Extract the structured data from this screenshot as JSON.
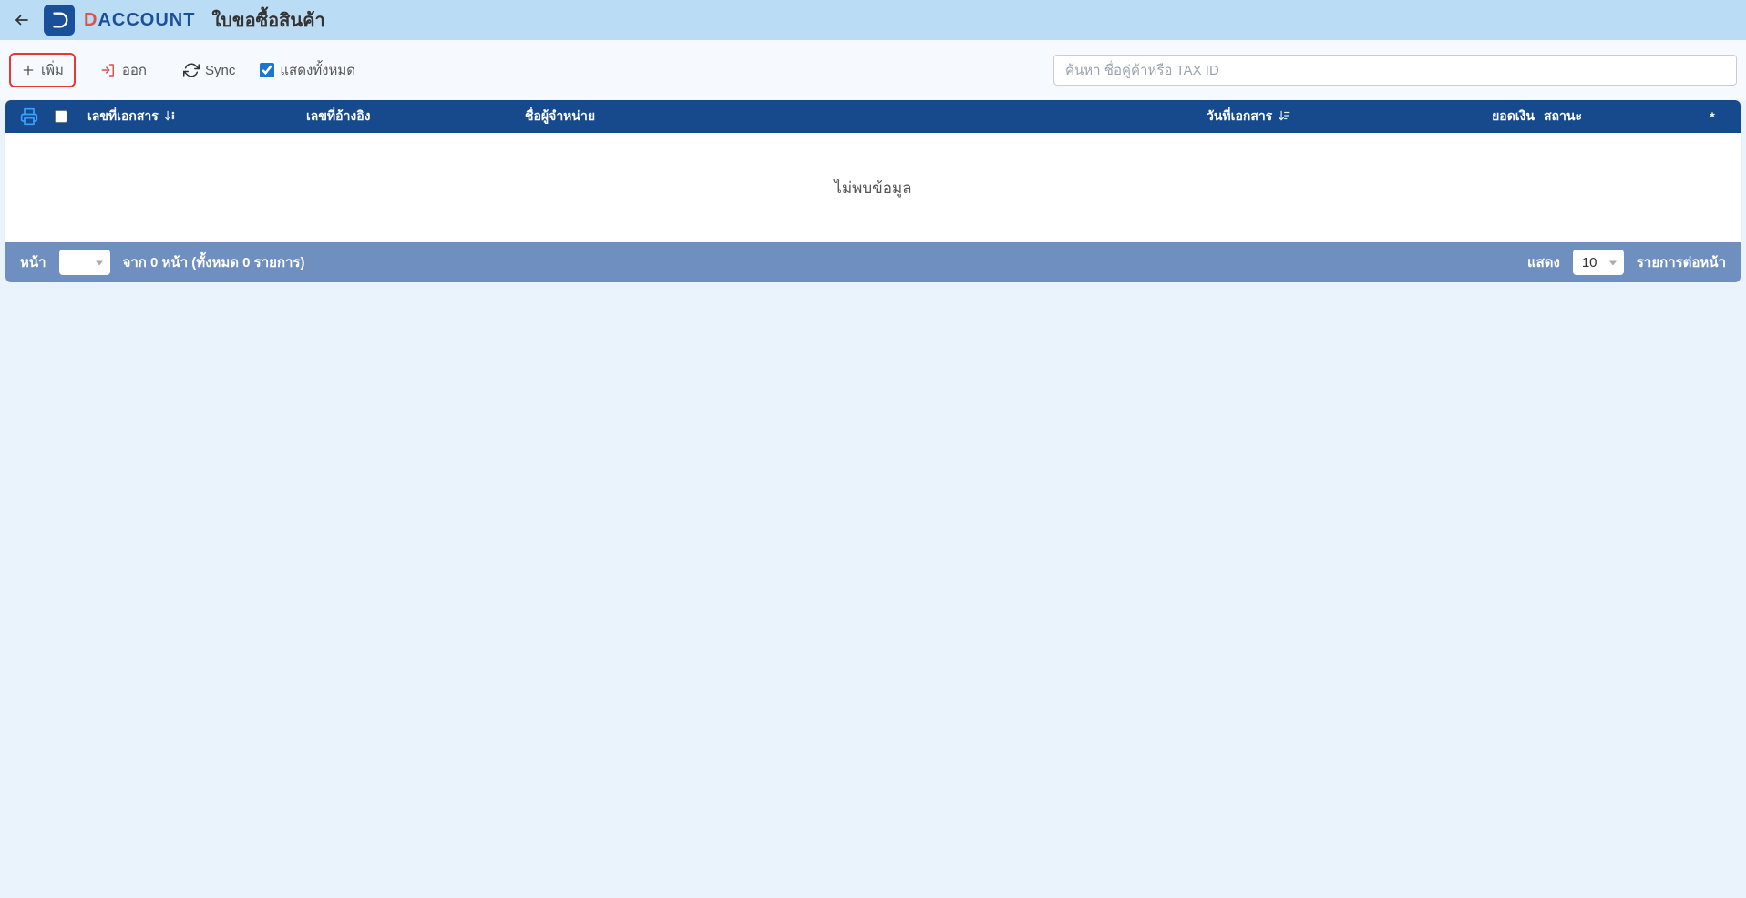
{
  "header": {
    "brand_d": "D",
    "brand_rest": "ACCOUNT",
    "page_title": "ใบขอซื้อสินค้า"
  },
  "toolbar": {
    "add_label": "เพิ่ม",
    "export_label": "ออก",
    "sync_label": "Sync",
    "show_all_label": "แสดงทั้งหมด",
    "show_all_checked": true,
    "search_placeholder": "ค้นหา ชื่อคู่ค้าหรือ TAX ID"
  },
  "table": {
    "columns": {
      "doc_no": "เลขที่เอกสาร",
      "ref_no": "เลขที่อ้างอิง",
      "vendor": "ชื่อผู้จำหน่าย",
      "doc_date": "วันที่เอกสาร",
      "amount": "ยอดเงิน",
      "status": "สถานะ",
      "star": "*"
    },
    "empty_message": "ไม่พบข้อมูล"
  },
  "pagination": {
    "page_label": "หน้า",
    "page_value": "",
    "summary": "จาก 0 หน้า (ทั้งหมด 0 รายการ)",
    "show_label": "แสดง",
    "per_page_value": "10",
    "per_page_label": "รายการต่อหน้า"
  }
}
